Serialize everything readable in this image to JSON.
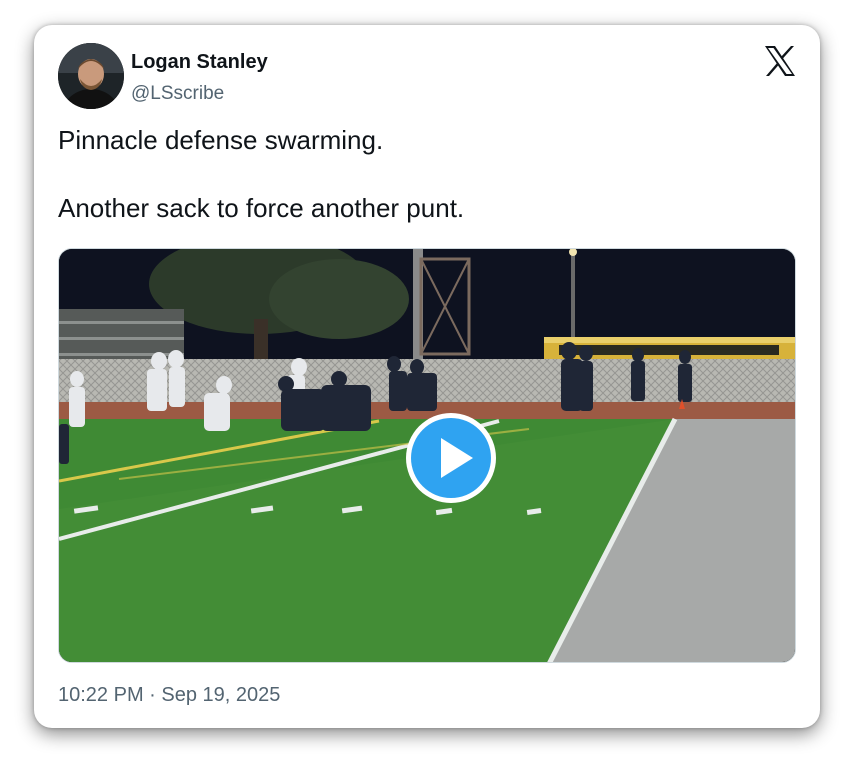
{
  "author": {
    "name": "Logan Stanley",
    "handle": "@LSscribe"
  },
  "tweet": {
    "lines": [
      "Pinnacle defense swarming.",
      "Another sack to force another punt."
    ],
    "timestamp": "10:22 PM · Sep 19, 2025"
  },
  "media": {
    "type": "video",
    "scene": "night high school football game, players lined up on green turf",
    "play_button_icon": "play-icon"
  },
  "brand": {
    "logo_icon": "x-logo-icon"
  },
  "colors": {
    "text_primary": "#0f1419",
    "text_secondary": "#536471",
    "play_button": "#1d9bf0"
  }
}
